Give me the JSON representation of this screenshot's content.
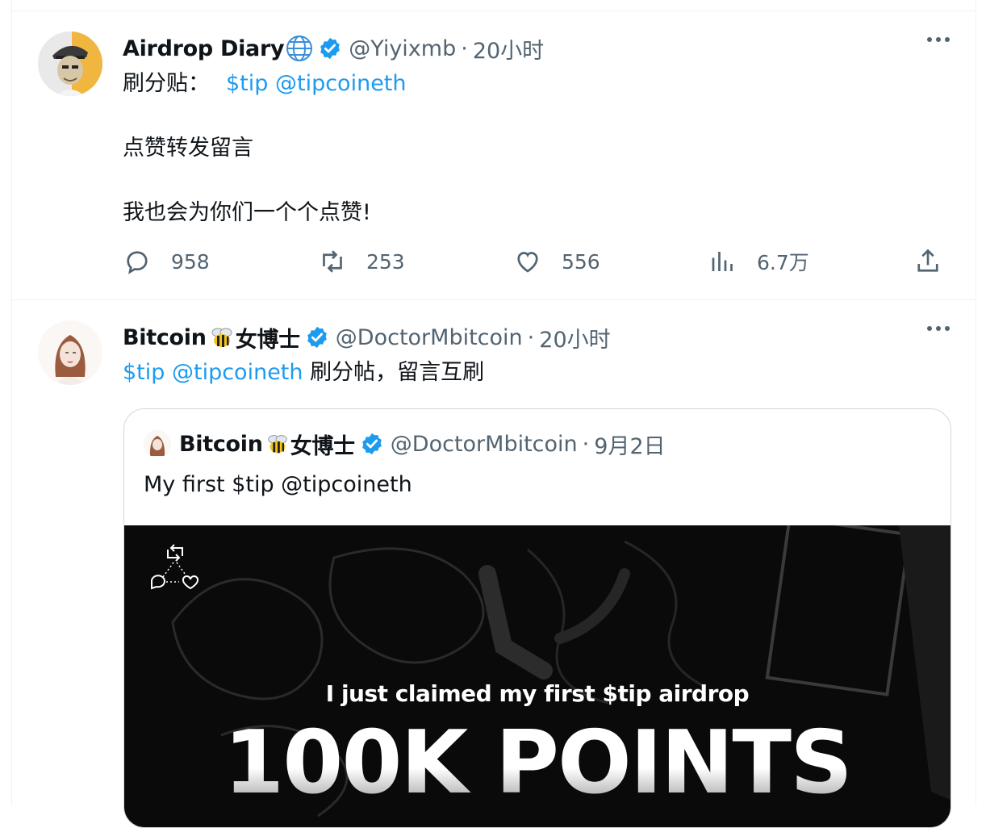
{
  "tweets": [
    {
      "author_name": "Airdrop Diary",
      "author_emoji": "globe-icon",
      "handle": "@Yiyixmb",
      "separator": "·",
      "time": "20小时",
      "text_prefix": "刷分贴：",
      "text_links": "$tip @tipcoineth",
      "line2": "点赞转发留言",
      "line3": "我也会为你们一个个点赞!",
      "stats": {
        "replies": "958",
        "retweets": "253",
        "likes": "556",
        "views": "6.7万"
      }
    },
    {
      "author_name": "Bitcoin",
      "author_emoji": "bee-icon",
      "author_suffix": "女博士",
      "handle": "@DoctorMbitcoin",
      "separator": "·",
      "time": "20小时",
      "text_links": "$tip @tipcoineth",
      "text_suffix": " 刷分帖，留言互刷",
      "quote": {
        "author_name": "Bitcoin",
        "author_suffix": "女博士",
        "handle": "@DoctorMbitcoin",
        "separator": "·",
        "time": "9月2日",
        "text": "My first $tip @tipcoineth",
        "media_subtitle": "I just claimed my first $tip airdrop",
        "media_title": "100K POINTS"
      }
    }
  ],
  "colors": {
    "link": "#1d9bf0",
    "secondary": "#536471",
    "verified": "#1d9bf0"
  }
}
